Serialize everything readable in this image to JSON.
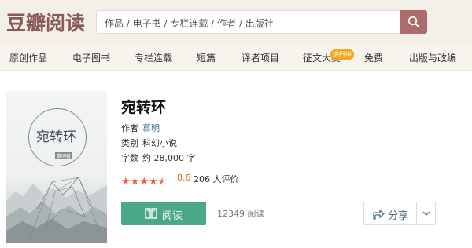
{
  "site": {
    "logo": "豆瓣阅读"
  },
  "search": {
    "placeholder": "作品 / 电子书 / 专栏连载 / 作者 / 出版社"
  },
  "nav": {
    "items": [
      {
        "label": "原创作品"
      },
      {
        "label": "电子图书"
      },
      {
        "label": "专栏连载"
      },
      {
        "label": "短篇"
      },
      {
        "label": "译者项目"
      },
      {
        "label": "征文大赛"
      },
      {
        "label": "免费"
      },
      {
        "label": "出版与改编"
      }
    ],
    "badge": "进行中"
  },
  "book": {
    "title": "宛转环",
    "cover_title": "宛转环",
    "cover_author": "慕明著",
    "author_key": "作者",
    "author": "慕明",
    "category_key": "类别",
    "category": "科幻小说",
    "wordcount_key": "字数",
    "wordcount": "约 28,000 字",
    "rating": "8.6",
    "rating_stars": 4.5,
    "rating_count": "206 人评价",
    "read_count": "12349 阅读"
  },
  "actions": {
    "read_label": "阅读",
    "share_label": "分享"
  },
  "colors": {
    "brand": "#8a5a55",
    "search_button": "#ad6b6b",
    "read_button": "#4ba789",
    "star": "#f45a38",
    "rating_text": "#e8641b",
    "link": "#4a6a8a"
  },
  "icons": [
    "search-icon",
    "book-icon",
    "share-icon",
    "chevron-down-icon",
    "star-icon"
  ]
}
